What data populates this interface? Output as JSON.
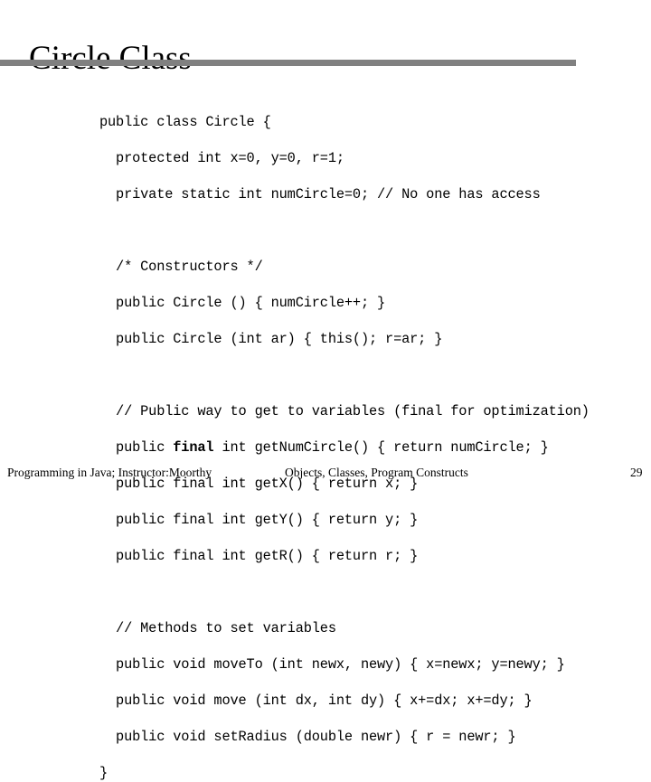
{
  "slide": {
    "title": "Circle Class",
    "rule_color": "#808080",
    "background_color": "#ffffff",
    "text_color": "#000000"
  },
  "code": {
    "language": "Java",
    "lines": [
      {
        "text": "public class Circle {"
      },
      {
        "text": "  protected int x=0, y=0, r=1;"
      },
      {
        "text": "  private static int numCircle=0; // No one has access"
      },
      {
        "text": ""
      },
      {
        "text": "  /* Constructors */"
      },
      {
        "text": "  public Circle () { numCircle++; }"
      },
      {
        "text": "  public Circle (int ar) { this(); r=ar; }"
      },
      {
        "text": ""
      },
      {
        "text": "  // Public way to get to variables (final for optimization)"
      },
      {
        "pre": "  public ",
        "bold": "final",
        "post": " int getNumCircle() { return numCircle; }"
      },
      {
        "text": "  public final int getX() { return x; }"
      },
      {
        "text": "  public final int getY() { return y; }"
      },
      {
        "text": "  public final int getR() { return r; }"
      },
      {
        "text": ""
      },
      {
        "text": "  // Methods to set variables"
      },
      {
        "text": "  public void moveTo (int newx, newy) { x=newx; y=newy; }"
      },
      {
        "text": "  public void move (int dx, int dy) { x+=dx; x+=dy; }"
      },
      {
        "text": "  public void setRadius (double newr) { r = newr; }"
      },
      {
        "text": "}"
      }
    ]
  },
  "footer": {
    "left": "Programming in Java; Instructor:Moorthy",
    "center": "Objects, Classes, Program Constructs",
    "page_number": "29"
  }
}
